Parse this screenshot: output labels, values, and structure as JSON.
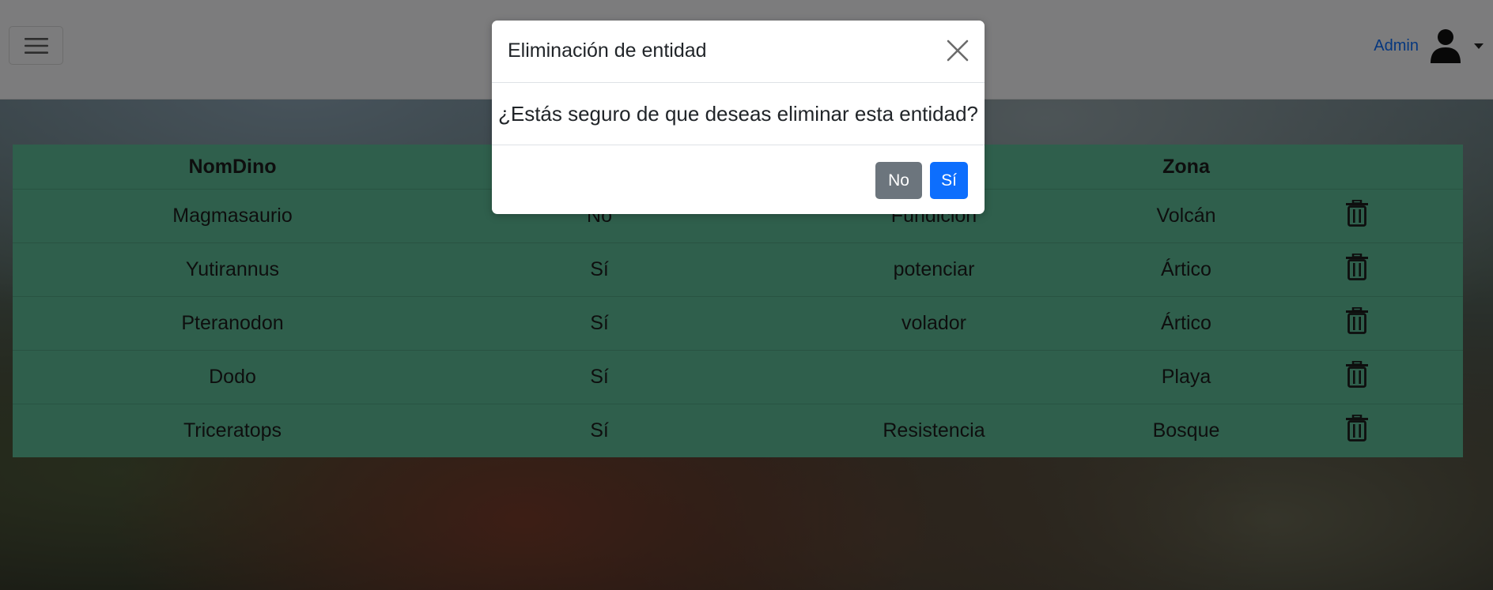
{
  "navbar": {
    "menu_icon": "hamburger-icon",
    "user_name": "Admin",
    "avatar_icon": "user-icon",
    "dropdown_icon": "caret-down-icon"
  },
  "table": {
    "headers": [
      "NomDino",
      "",
      "",
      "Zona",
      ""
    ],
    "rows": [
      {
        "nom": "Magmasaurio",
        "col2": "No",
        "col3": "Fundición",
        "zona": "Volcán"
      },
      {
        "nom": "Yutirannus",
        "col2": "Sí",
        "col3": "potenciar",
        "zona": "Ártico"
      },
      {
        "nom": "Pteranodon",
        "col2": "Sí",
        "col3": "volador",
        "zona": "Ártico"
      },
      {
        "nom": "Dodo",
        "col2": "Sí",
        "col3": "",
        "zona": "Playa"
      },
      {
        "nom": "Triceratops",
        "col2": "Sí",
        "col3": "Resistencia",
        "zona": "Bosque"
      }
    ],
    "row_action_icon": "trash-icon"
  },
  "modal": {
    "title": "Eliminación de entidad",
    "message": "¿Estás seguro de que deseas eliminar esta entidad?",
    "close_icon": "close-icon",
    "no_label": "No",
    "yes_label": "Sí"
  },
  "colors": {
    "table_bg": "#5fbf98",
    "primary": "#0d6efd",
    "secondary": "#6c757d",
    "backdrop": "rgba(0,0,0,0.5)"
  }
}
